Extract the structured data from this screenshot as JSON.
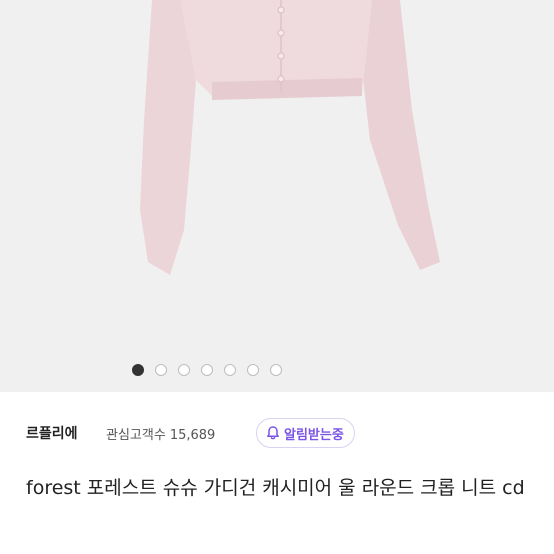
{
  "gallery": {
    "image_alt": "light pink cropped cardigan",
    "dots_total": 7,
    "active_index": 0,
    "colors": {
      "background": "#f1f0f0",
      "garment": "#ecd5d8",
      "button": "#f4e6e8"
    }
  },
  "shop": {
    "name": "르플리에",
    "followers_label": "관심고객수",
    "followers_count": "15,689",
    "alert_button_label": "알림받는중",
    "alert_icon": "bell-icon",
    "accent_color": "#7b55e6"
  },
  "product": {
    "title": "forest 포레스트 슈슈 가디건 캐시미어 울 라운드 크롭 니트 cd"
  }
}
